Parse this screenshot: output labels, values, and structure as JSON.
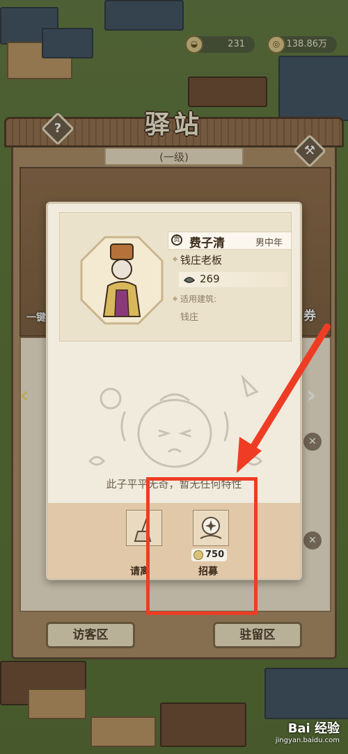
{
  "currency": {
    "item1_value": "231",
    "item2_value": "138.86万"
  },
  "station": {
    "title": "驿站",
    "level": "(一级)",
    "help_icon": "?",
    "visitor_button": "访客区",
    "stay_button": "驻留区"
  },
  "background_labels": {
    "left_partial": "一键",
    "right_partial": "券"
  },
  "popup": {
    "name": "费子清",
    "rank_icon": "贡",
    "gender_age": "男中年",
    "profession": "钱庄老板",
    "stat_value": "269",
    "building_label": "适用建筑:",
    "building_value": "钱庄",
    "description": "此子平平无奇，暂无任何特性",
    "actions": {
      "dismiss_label": "请离",
      "recruit_label": "招募",
      "recruit_cost": "750"
    }
  },
  "watermark": {
    "main": "Bai 经验",
    "sub": "jingyan.baidu.com"
  },
  "colors": {
    "annotation_red": "#ee3d24",
    "panel_brown": "#a88a66",
    "popup_cream": "#f1ebdd"
  }
}
